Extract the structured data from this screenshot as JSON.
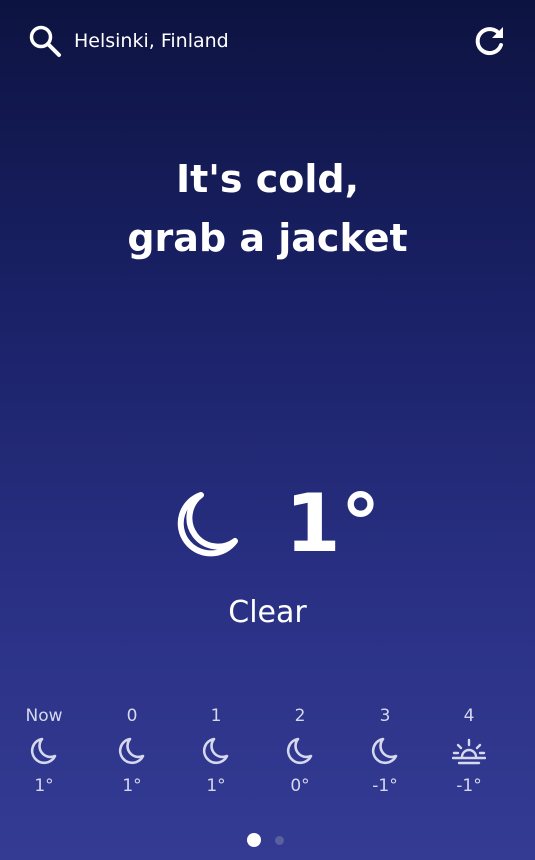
{
  "header": {
    "location": "Helsinki, Finland",
    "search_icon": "search-icon",
    "refresh_icon": "refresh-icon"
  },
  "message": {
    "line1": "It's cold,",
    "line2": "grab a jacket"
  },
  "current": {
    "icon": "moon-icon",
    "temperature": "1°",
    "condition": "Clear"
  },
  "forecast": [
    {
      "hour": "Now",
      "icon": "moon-icon",
      "temp": "1°"
    },
    {
      "hour": "0",
      "icon": "moon-icon",
      "temp": "1°"
    },
    {
      "hour": "1",
      "icon": "moon-icon",
      "temp": "1°"
    },
    {
      "hour": "2",
      "icon": "moon-icon",
      "temp": "0°"
    },
    {
      "hour": "3",
      "icon": "moon-icon",
      "temp": "-1°"
    },
    {
      "hour": "4",
      "icon": "sunrise-icon",
      "temp": "-1°"
    }
  ],
  "pagination": {
    "pages": 2,
    "active": 1
  },
  "colors": {
    "background_top": "#0d1340",
    "background_bottom": "#343b93",
    "text": "#ffffff",
    "muted_text": "#d6d8ee"
  }
}
